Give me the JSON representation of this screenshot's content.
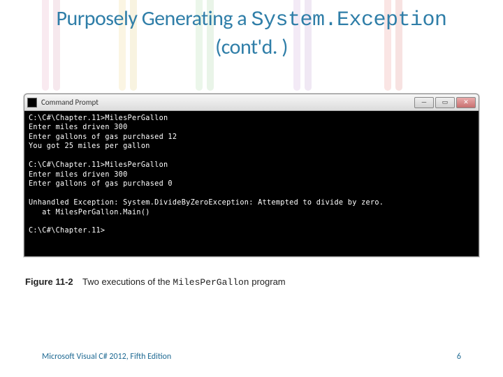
{
  "title": {
    "pre": "Purposely Generating a ",
    "mono": "System.Exception",
    "post": " (cont'd. )"
  },
  "cmd": {
    "window_label": "Command Prompt",
    "lines": [
      "C:\\C#\\Chapter.11>MilesPerGallon",
      "Enter miles driven 300",
      "Enter gallons of gas purchased 12",
      "You got 25 miles per gallon",
      "",
      "C:\\C#\\Chapter.11>MilesPerGallon",
      "Enter miles driven 300",
      "Enter gallons of gas purchased 0",
      "",
      "Unhandled Exception: System.DivideByZeroException: Attempted to divide by zero.",
      "   at MilesPerGallon.Main()",
      "",
      "C:\\C#\\Chapter.11>"
    ],
    "buttons": {
      "min": "—",
      "max": "▭",
      "close": "✕"
    }
  },
  "figure": {
    "label": "Figure 11-2",
    "caption_pre": "Two executions of the ",
    "caption_mono": "MilesPerGallon",
    "caption_post": " program"
  },
  "footer": {
    "left": "Microsoft Visual C# 2012, Fifth Edition",
    "page": "6"
  }
}
